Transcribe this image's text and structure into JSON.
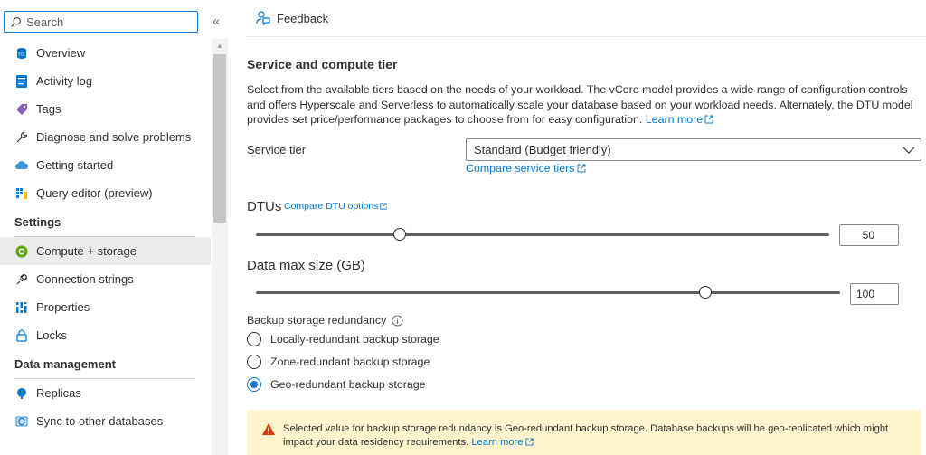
{
  "sidebar": {
    "search_placeholder": "Search",
    "collapse_glyph": "«",
    "items_top": [
      {
        "label": "Overview",
        "icon": "sql-database-icon"
      },
      {
        "label": "Activity log",
        "icon": "activity-log-icon"
      },
      {
        "label": "Tags",
        "icon": "tag-icon"
      },
      {
        "label": "Diagnose and solve problems",
        "icon": "wrench-icon"
      },
      {
        "label": "Getting started",
        "icon": "cloud-icon"
      },
      {
        "label": "Query editor (preview)",
        "icon": "query-editor-icon"
      }
    ],
    "settings_header": "Settings",
    "settings_items": [
      {
        "label": "Compute + storage",
        "icon": "compute-icon",
        "active": true
      },
      {
        "label": "Connection strings",
        "icon": "plug-icon"
      },
      {
        "label": "Properties",
        "icon": "properties-icon"
      },
      {
        "label": "Locks",
        "icon": "lock-icon"
      }
    ],
    "data_header": "Data management",
    "data_items": [
      {
        "label": "Replicas",
        "icon": "globe-icon"
      },
      {
        "label": "Sync to other databases",
        "icon": "sync-icon"
      }
    ]
  },
  "toolbar": {
    "feedback_label": "Feedback"
  },
  "main": {
    "section_title": "Service and compute tier",
    "description": "Select from the available tiers based on the needs of your workload. The vCore model provides a wide range of configuration controls and offers Hyperscale and Serverless to automatically scale your database based on your workload needs. Alternately, the DTU model provides set price/performance packages to choose from for easy configuration. ",
    "description_link": "Learn more",
    "service_tier_label": "Service tier",
    "service_tier_value": "Standard (Budget friendly)",
    "compare_tiers_link": "Compare service tiers",
    "dtu_label": "DTUs",
    "dtu_link": "Compare DTU options",
    "dtu_value": "50",
    "dtu_fraction": 0.25,
    "data_size_label": "Data max size (GB)",
    "data_size_value": "100",
    "data_size_fraction": 0.77,
    "backup_label": "Backup storage redundancy",
    "backup_options": [
      {
        "label": "Locally-redundant backup storage",
        "checked": false
      },
      {
        "label": "Zone-redundant backup storage",
        "checked": false
      },
      {
        "label": "Geo-redundant backup storage",
        "checked": true
      }
    ],
    "warning_text": "Selected value for backup storage redundancy is Geo-redundant backup storage. Database backups will be geo-replicated which might impact your data residency requirements. ",
    "warning_link": "Learn more"
  },
  "colors": {
    "accent": "#0078d4",
    "warning_bg": "#fff4ce",
    "warning_icon": "#d83b01"
  }
}
